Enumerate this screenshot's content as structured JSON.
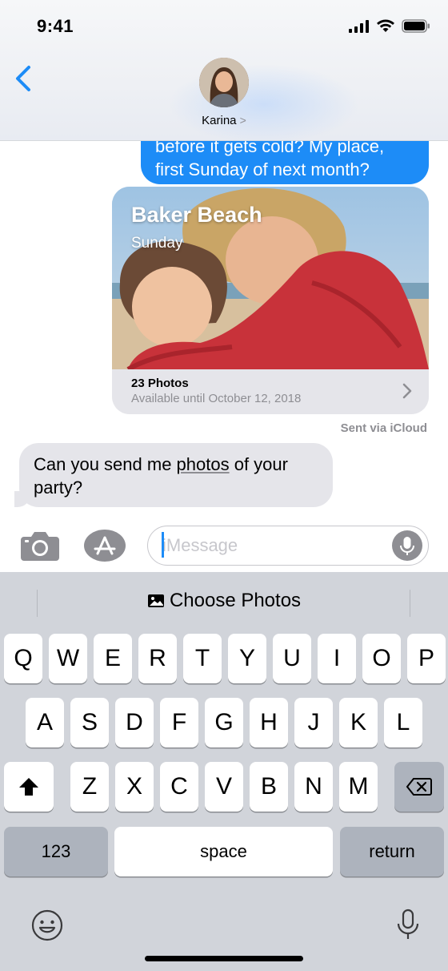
{
  "status_bar": {
    "time": "9:41"
  },
  "header": {
    "contact_name": "Karina",
    "name_chevron": ">"
  },
  "messages": {
    "outgoing_text": "before it gets cold? My place, first Sunday of next month?",
    "photo_card": {
      "title": "Baker Beach",
      "subtitle": "Sunday",
      "count": "23 Photos",
      "availability": "Available until October 12, 2018"
    },
    "sent_via": "Sent via iCloud",
    "incoming_text_before": "Can you send me ",
    "incoming_text_link": "photos",
    "incoming_text_after": " of your party?"
  },
  "input": {
    "placeholder": "iMessage"
  },
  "keyboard": {
    "suggestion": "Choose Photos",
    "row1": [
      "Q",
      "W",
      "E",
      "R",
      "T",
      "Y",
      "U",
      "I",
      "O",
      "P"
    ],
    "row2": [
      "A",
      "S",
      "D",
      "F",
      "G",
      "H",
      "J",
      "K",
      "L"
    ],
    "row3": [
      "Z",
      "X",
      "C",
      "V",
      "B",
      "N",
      "M"
    ],
    "numbers_label": "123",
    "space_label": "space",
    "return_label": "return"
  },
  "colors": {
    "accent": "#1d8cf7",
    "bubble_in": "#e5e5ea",
    "keyboard_bg": "#d1d4da"
  }
}
